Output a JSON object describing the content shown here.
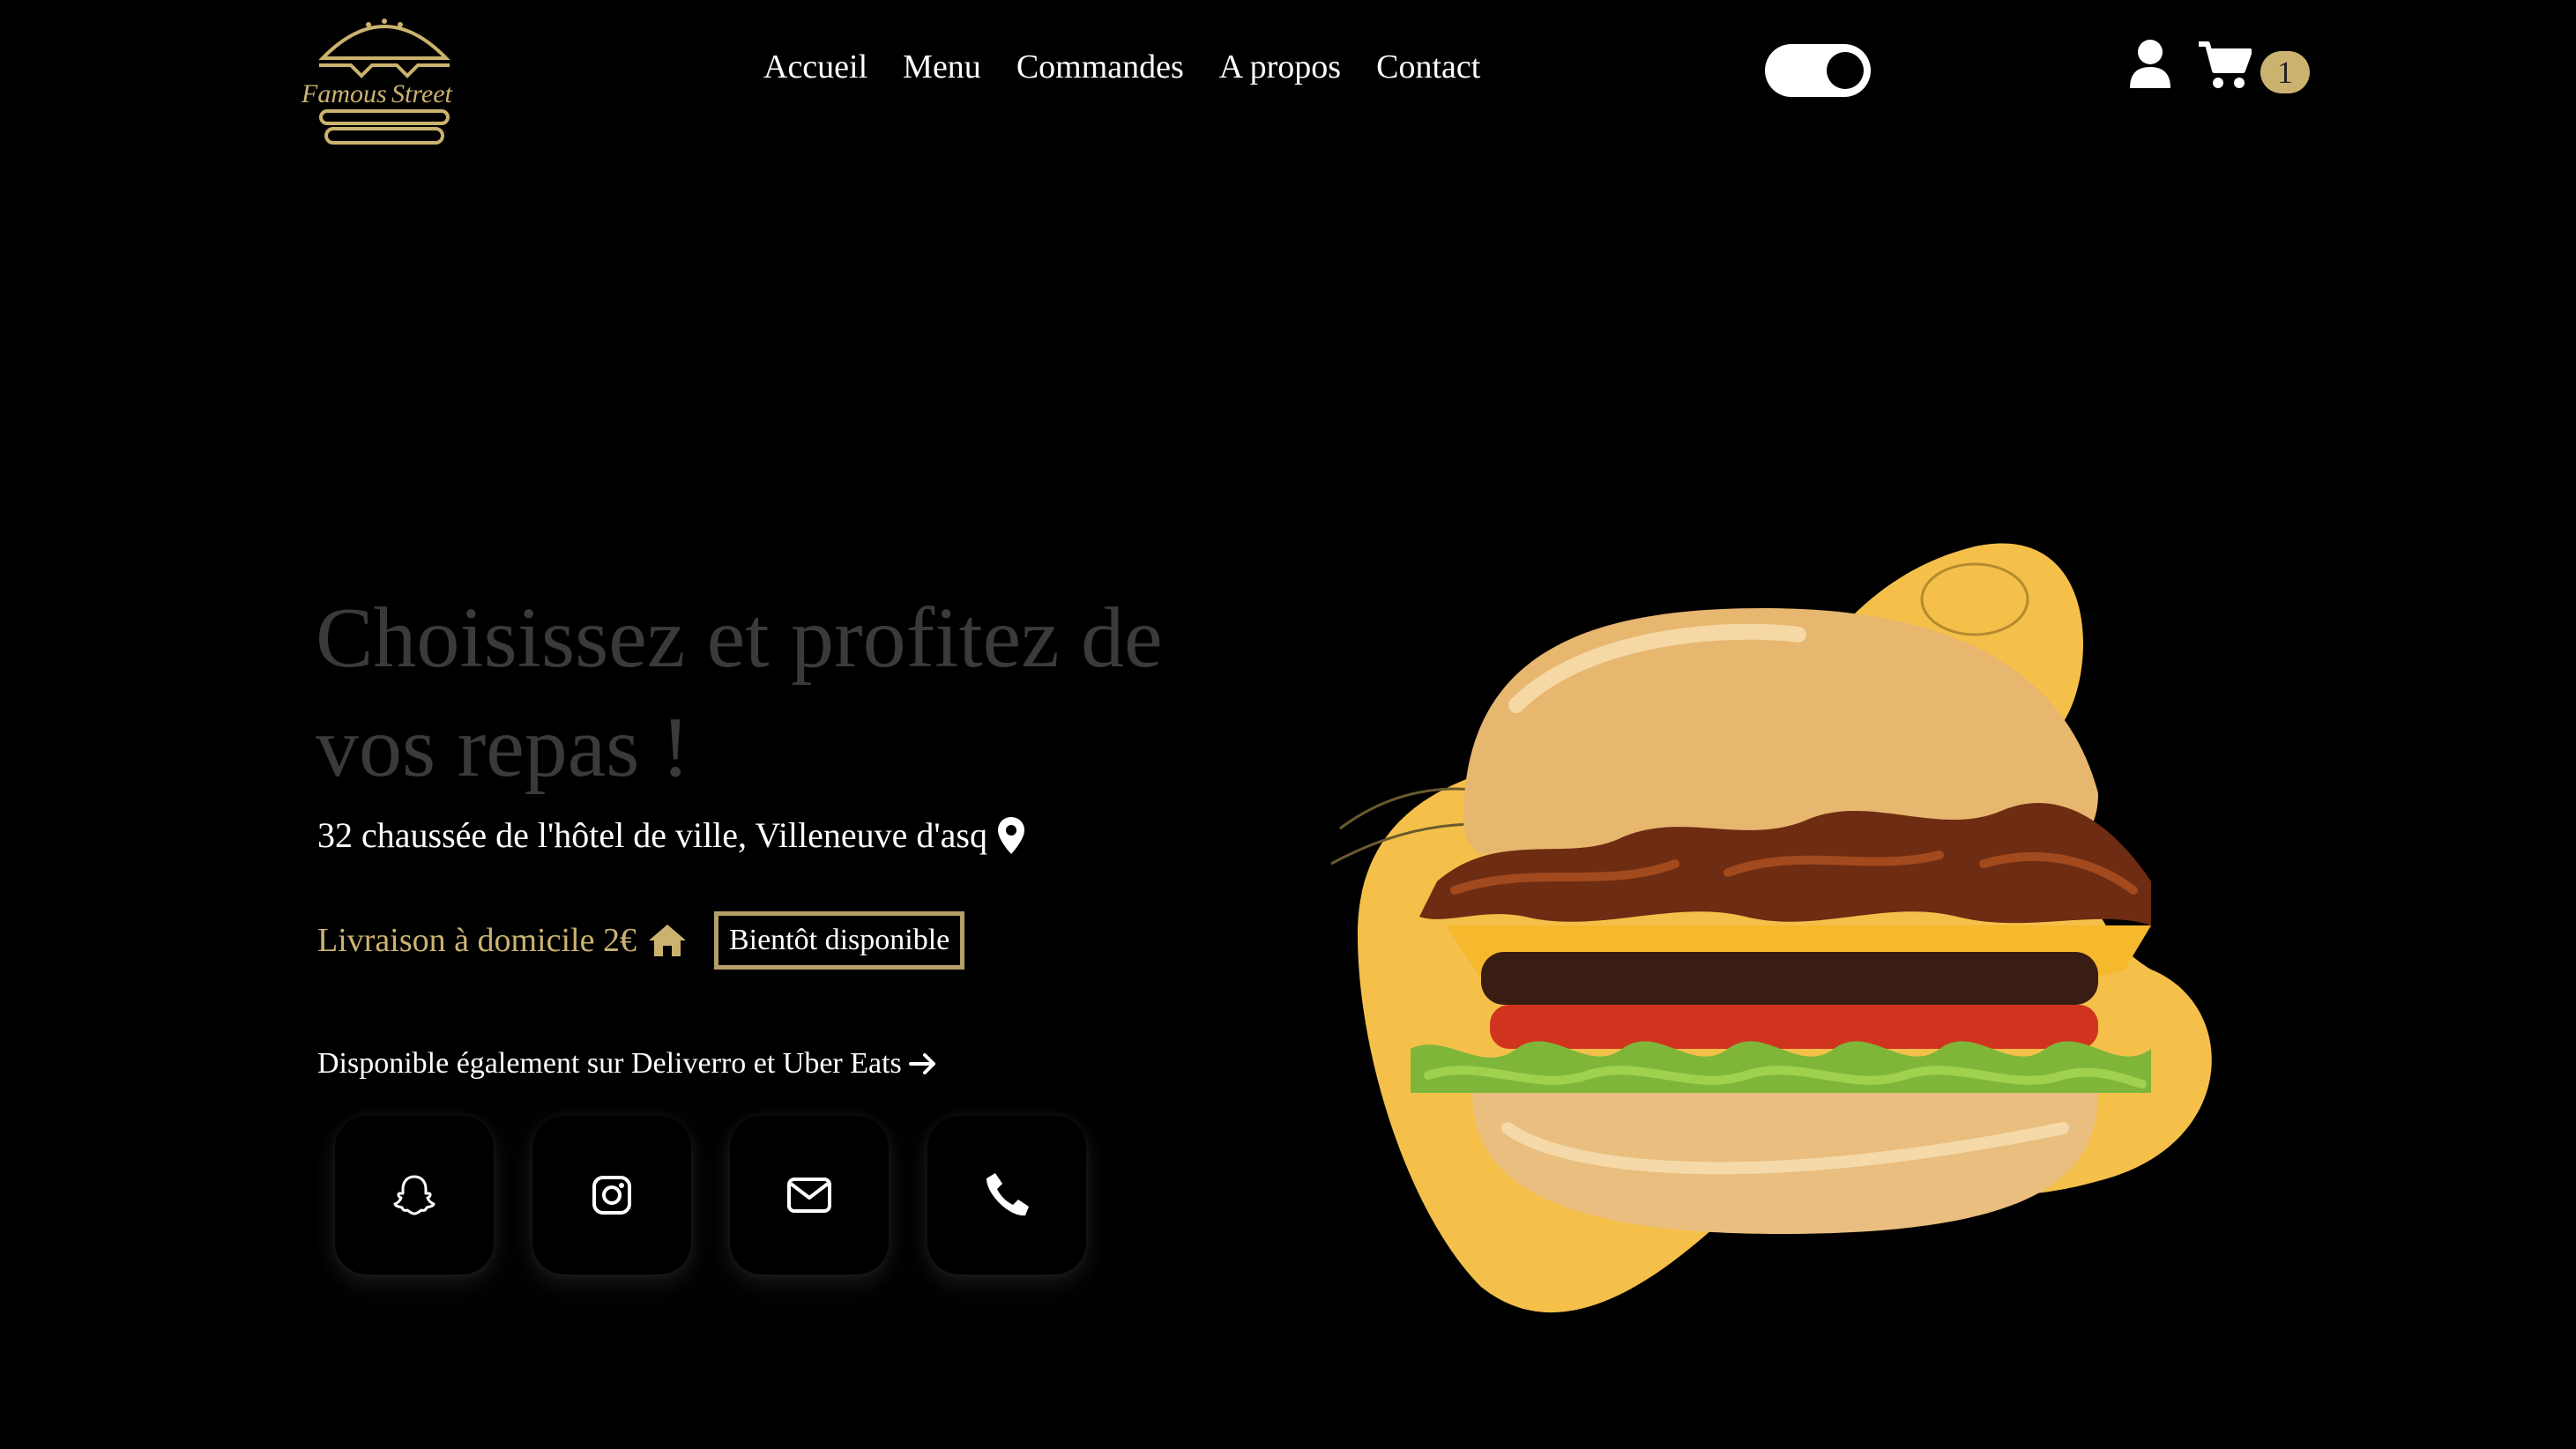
{
  "brand": {
    "logo_line1": "Famous",
    "logo_line2": "Street"
  },
  "nav": {
    "items": [
      "Accueil",
      "Menu",
      "Commandes",
      "A propos",
      "Contact"
    ]
  },
  "header": {
    "cart_count": "1",
    "theme_toggle_on": true
  },
  "hero": {
    "headline": "Choisissez et profitez de vos repas !",
    "address": "32 chaussée de l'hôtel de ville, Villeneuve d'asq",
    "delivery_text": "Livraison à domicile 2€",
    "badge": "Bientôt disponible",
    "also_available": "Disponible également sur Deliverro et Uber Eats"
  },
  "socials": [
    {
      "icon": "snapchat-icon"
    },
    {
      "icon": "instagram-icon"
    },
    {
      "icon": "mail-icon"
    },
    {
      "icon": "phone-icon"
    }
  ],
  "colors": {
    "background": "#000000",
    "accent_gold": "#cbb36f",
    "blob_yellow": "#f4c04a"
  }
}
